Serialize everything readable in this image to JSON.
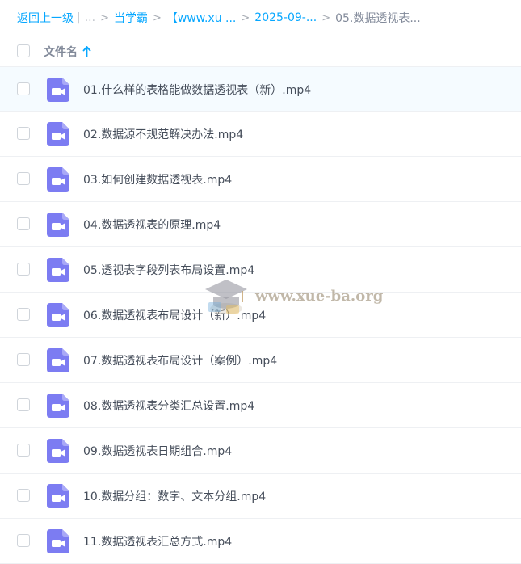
{
  "breadcrumb": {
    "back": "返回上一级",
    "ellipsis": "...",
    "crumbs": [
      "当学霸",
      "【www.xu ...",
      "2025-09-..."
    ],
    "current": "05.数据透视表..."
  },
  "header": {
    "column_name": "文件名",
    "sort_icon": "arrow-up-icon"
  },
  "files": [
    "01.什么样的表格能做数据透视表（新）.mp4",
    "02.数据源不规范解决办法.mp4",
    "03.如何创建数据透视表.mp4",
    "04.数据透视表的原理.mp4",
    "05.透视表字段列表布局设置.mp4",
    "06.数据透视表布局设计（新）.mp4",
    "07.数据透视表布局设计（案例）.mp4",
    "08.数据透视表分类汇总设置.mp4",
    "09.数据透视表日期组合.mp4",
    "10.数据分组：数字、文本分组.mp4",
    "11.数据透视表汇总方式.mp4"
  ],
  "file_icon": "video-file-icon",
  "watermark": {
    "text": "www.xue-ba.org"
  },
  "colors": {
    "link": "#06a7ff",
    "video_icon": "#7c7cf2",
    "hover_row": "#f5fbff"
  }
}
